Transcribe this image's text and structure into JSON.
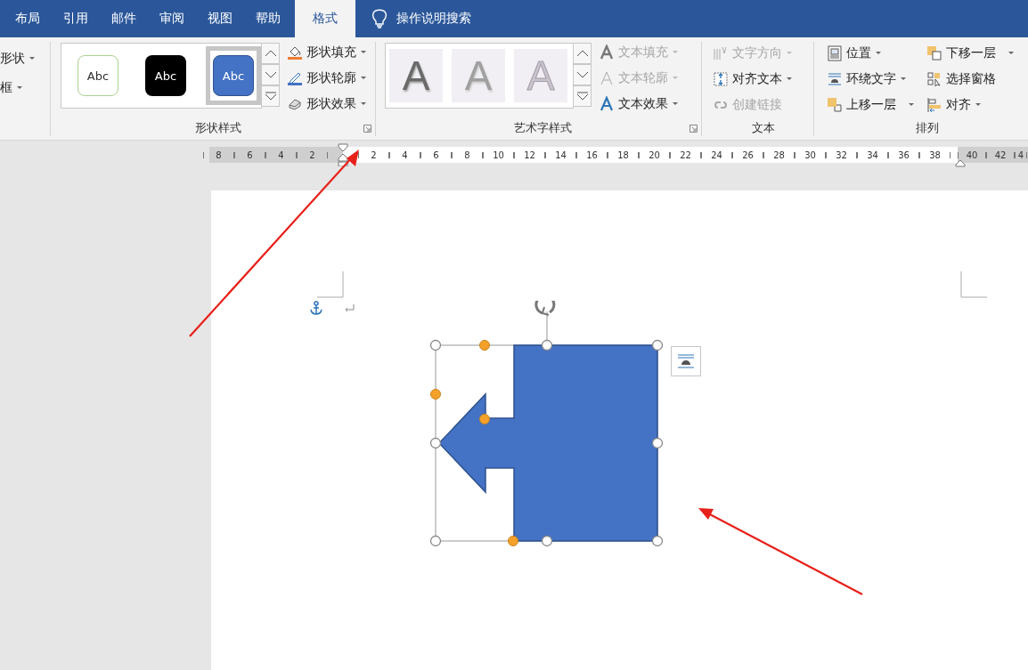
{
  "tabs": [
    {
      "label": "布局",
      "selected": false
    },
    {
      "label": "引用",
      "selected": false
    },
    {
      "label": "邮件",
      "selected": false
    },
    {
      "label": "审阅",
      "selected": false
    },
    {
      "label": "视图",
      "selected": false
    },
    {
      "label": "帮助",
      "selected": false
    },
    {
      "label": "格式",
      "selected": true
    }
  ],
  "tell_me": {
    "placeholder": "操作说明搜索"
  },
  "ribbon": {
    "groups": [
      {
        "kind": "clipped",
        "commands": [
          {
            "label": "形状",
            "disabled": false,
            "dropdown": true
          },
          {
            "label": "框",
            "disabled": false,
            "dropdown": true
          }
        ]
      },
      {
        "kind": "shape_styles",
        "label": "形状样式",
        "gallery": [
          {
            "kind": "outline",
            "text": "Abc",
            "selected": false
          },
          {
            "kind": "black",
            "text": "Abc",
            "selected": false
          },
          {
            "kind": "blue",
            "text": "Abc",
            "selected": true
          }
        ],
        "commands": [
          {
            "label": "形状填充",
            "disabled": false,
            "dropdown": true
          },
          {
            "label": "形状轮廓",
            "disabled": false,
            "dropdown": true
          },
          {
            "label": "形状效果",
            "disabled": false,
            "dropdown": true
          }
        ]
      },
      {
        "kind": "wordart",
        "label": "艺术字样式",
        "gallery": [
          {
            "kind": "dark",
            "text": "A",
            "selected": false
          },
          {
            "kind": "medium",
            "text": "A",
            "selected": false
          },
          {
            "kind": "light",
            "text": "A",
            "selected": false
          }
        ],
        "commands": [
          {
            "label": "文本填充",
            "disabled": true,
            "dropdown": true
          },
          {
            "label": "文本轮廓",
            "disabled": true,
            "dropdown": true
          },
          {
            "label": "文本效果",
            "disabled": false,
            "dropdown": true
          }
        ]
      },
      {
        "kind": "text",
        "label": "文本",
        "commands": [
          {
            "label": "文字方向",
            "disabled": true,
            "dropdown": true
          },
          {
            "label": "对齐文本",
            "disabled": false,
            "dropdown": true
          },
          {
            "label": "创建链接",
            "disabled": true,
            "dropdown": false
          }
        ]
      },
      {
        "kind": "arrange",
        "label": "排列",
        "commands": [
          {
            "label": "位置",
            "disabled": false,
            "dropdown": true
          },
          {
            "label": "下移一层",
            "disabled": false,
            "dropdown": true
          },
          {
            "label": "环绕文字",
            "disabled": false,
            "dropdown": true
          },
          {
            "label": "选择窗格",
            "disabled": false,
            "dropdown": false
          },
          {
            "label": "上移一层",
            "disabled": false,
            "dropdown": true
          },
          {
            "label": "对齐",
            "disabled": false,
            "dropdown": true
          }
        ]
      }
    ]
  },
  "ruler": {
    "left_numbers": [
      "8",
      "6",
      "4",
      "2"
    ],
    "numbers": [
      "2",
      "4",
      "6",
      "8",
      "10",
      "12",
      "14",
      "16",
      "18",
      "20",
      "22",
      "24",
      "26",
      "28",
      "30",
      "32",
      "34",
      "36",
      "38"
    ],
    "right_numbers": [
      "40",
      "42",
      "4"
    ]
  }
}
